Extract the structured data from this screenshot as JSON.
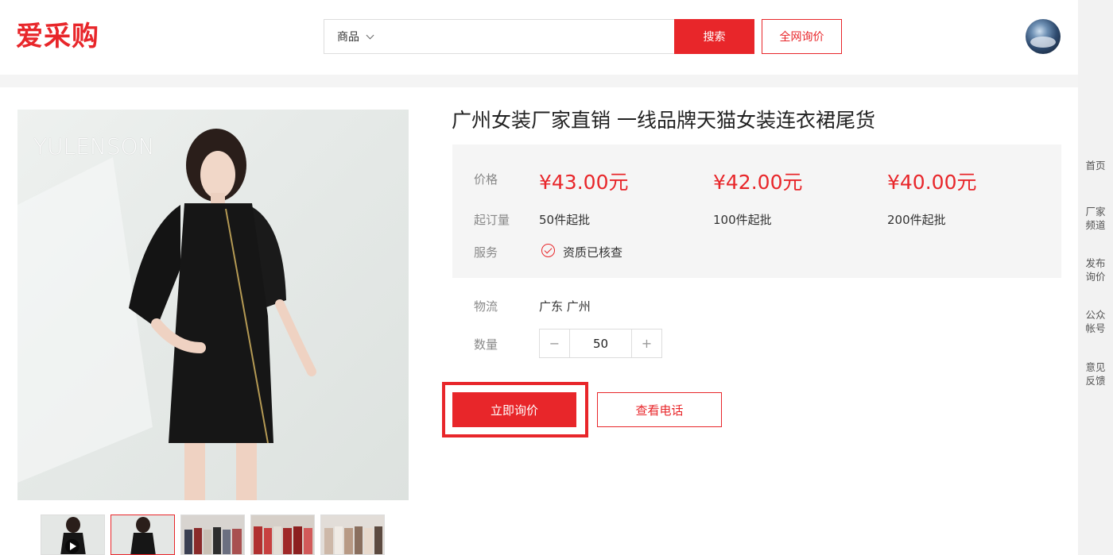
{
  "header": {
    "logo": "爱采购",
    "search": {
      "category": "商品",
      "placeholder": "",
      "button": "搜索"
    },
    "inquiry_button": "全网询价"
  },
  "sidebar": {
    "items": [
      "首页",
      "厂家\n频道",
      "发布\n询价",
      "公众\n帐号",
      "意见\n反馈"
    ]
  },
  "product": {
    "image_watermark": "YULENSON",
    "title": "广州女装厂家直销 一线品牌天猫女装连衣裙尾货",
    "price_label": "价格",
    "prices": [
      "¥43.00元",
      "¥42.00元",
      "¥40.00元"
    ],
    "moq_label": "起订量",
    "moqs": [
      "50件起批",
      "100件起批",
      "200件起批"
    ],
    "service_label": "服务",
    "service_value": "资质已核查",
    "logistics_label": "物流",
    "logistics_value": "广东 广州",
    "quantity_label": "数量",
    "quantity": {
      "minus": "−",
      "value": "50",
      "plus": "+"
    },
    "actions": {
      "inquire": "立即询价",
      "phone": "查看电话"
    }
  },
  "colors": {
    "accent": "#e8262a"
  }
}
